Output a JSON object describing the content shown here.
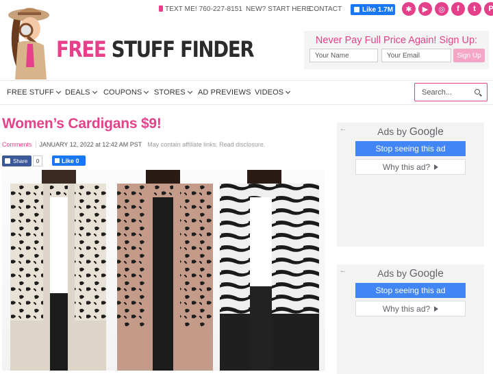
{
  "topbar": {
    "text_me": "TEXT ME! 760-227-8151",
    "new_start": "NEW? START HERE",
    "contact": "CONTACT",
    "fb_like": "Like 1.7M",
    "socials": [
      {
        "name": "snapchat-icon",
        "glyph": "✱"
      },
      {
        "name": "youtube-icon",
        "glyph": "▶"
      },
      {
        "name": "instagram-icon",
        "glyph": "◎"
      },
      {
        "name": "facebook-icon",
        "glyph": "f"
      },
      {
        "name": "twitter-icon",
        "glyph": "t"
      },
      {
        "name": "pinterest-icon",
        "glyph": "P"
      }
    ]
  },
  "header": {
    "logo_free": "FREE",
    "logo_rest": "STUFF FINDER",
    "signup_title": "Never Pay Full Price Again! Sign Up:",
    "name_placeholder": "Your Name",
    "email_placeholder": "Your Email",
    "signup_button": "Sign Up"
  },
  "nav": {
    "items": [
      "FREE STUFF",
      "DEALS",
      "COUPONS",
      "STORES",
      "AD PREVIEWS",
      "VIDEOS"
    ],
    "search_placeholder": "Search..."
  },
  "post": {
    "title": "Women’s Cardigans $9!",
    "comments": "Comments",
    "date": "JANUARY 12, 2022 at 12:42 AM PST",
    "disclosure": "May contain affiliate links. Read disclosure.",
    "share_label": "Share",
    "share_count": "0",
    "like_label": "Like 0"
  },
  "ads": [
    {
      "ads_by": "Ads by",
      "google": "Google",
      "stop": "Stop seeing this ad",
      "why": "Why this ad?"
    },
    {
      "ads_by": "Ads by",
      "google": "Google",
      "stop": "Stop seeing this ad",
      "why": "Why this ad?"
    }
  ],
  "colors": {
    "brand_pink": "#e5418a",
    "facebook_blue": "#1877f2",
    "google_blue": "#4285f4"
  }
}
